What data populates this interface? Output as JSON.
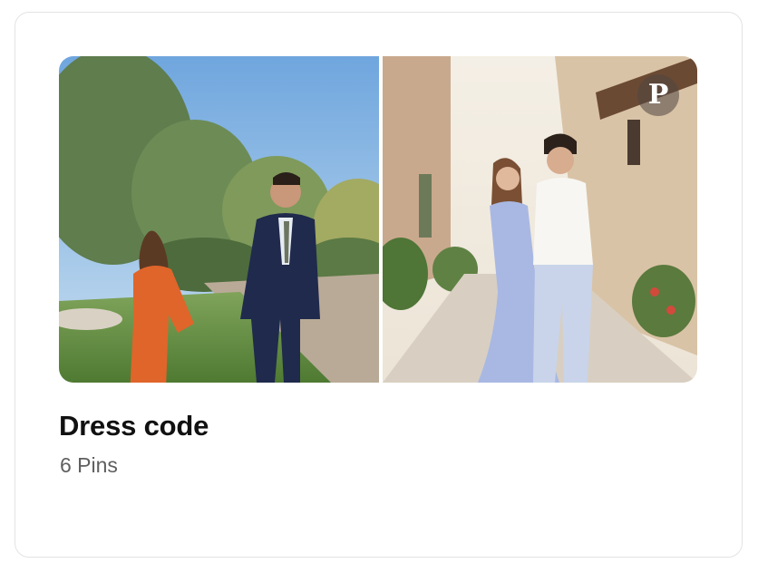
{
  "board": {
    "title": "Dress code",
    "pin_count": "6 Pins"
  },
  "images": {
    "left": "photo-couple-garden",
    "right": "photo-couple-alley"
  },
  "icons": {
    "pin_badge": "P"
  },
  "colors": {
    "card_border": "#e3e3e3",
    "title": "#111111",
    "subtitle": "#5f5f5f"
  }
}
